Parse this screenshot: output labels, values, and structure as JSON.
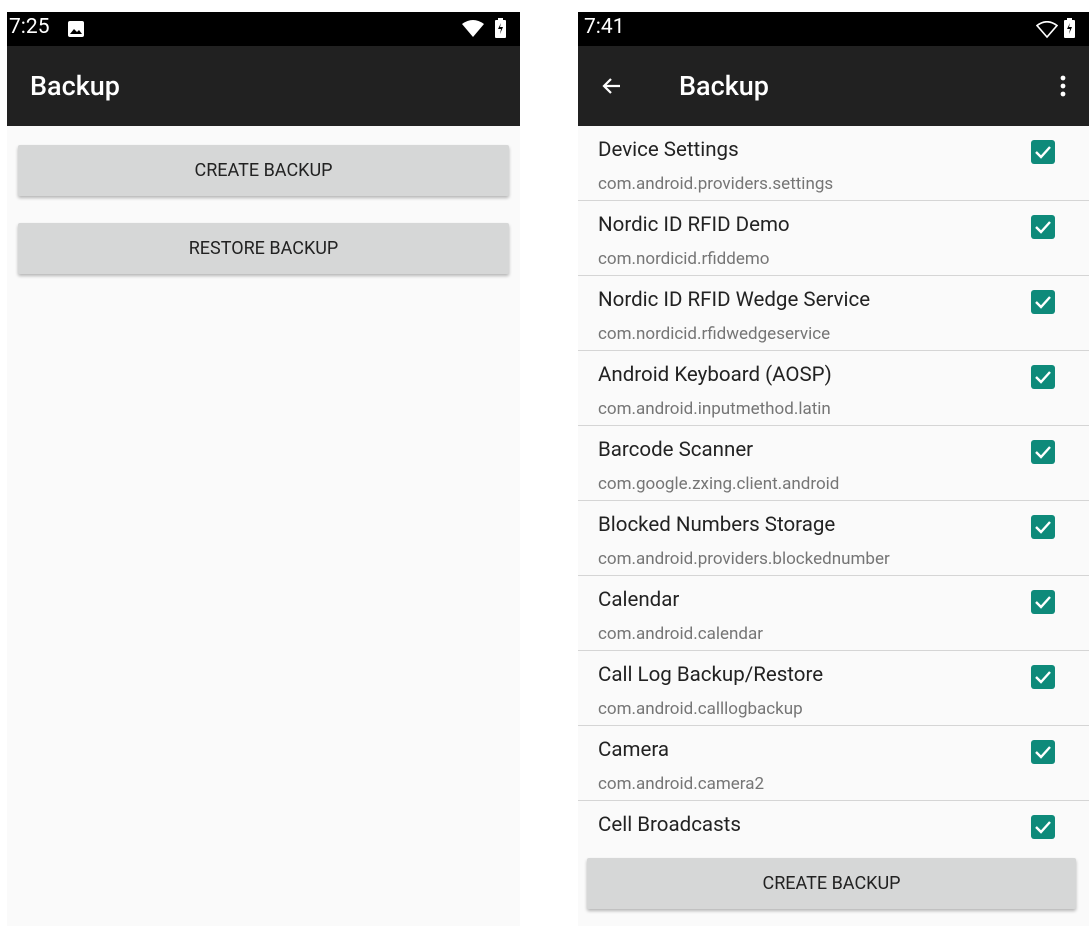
{
  "left_screen": {
    "status": {
      "time": "7:25"
    },
    "appbar": {
      "title": "Backup"
    },
    "buttons": {
      "create_label": "CREATE BACKUP",
      "restore_label": "RESTORE BACKUP"
    }
  },
  "right_screen": {
    "status": {
      "time": "7:41"
    },
    "appbar": {
      "title": "Backup"
    },
    "apps": [
      {
        "name": "Device Settings",
        "package": "com.android.providers.settings",
        "checked": true
      },
      {
        "name": "Nordic ID RFID Demo",
        "package": "com.nordicid.rfiddemo",
        "checked": true
      },
      {
        "name": "Nordic ID RFID Wedge Service",
        "package": "com.nordicid.rfidwedgeservice",
        "checked": true
      },
      {
        "name": "Android Keyboard (AOSP)",
        "package": "com.android.inputmethod.latin",
        "checked": true
      },
      {
        "name": "Barcode Scanner",
        "package": "com.google.zxing.client.android",
        "checked": true
      },
      {
        "name": "Blocked Numbers Storage",
        "package": "com.android.providers.blockednumber",
        "checked": true
      },
      {
        "name": "Calendar",
        "package": "com.android.calendar",
        "checked": true
      },
      {
        "name": "Call Log Backup/Restore",
        "package": "com.android.calllogbackup",
        "checked": true
      },
      {
        "name": "Camera",
        "package": "com.android.camera2",
        "checked": true
      },
      {
        "name": "Cell Broadcasts",
        "package": "",
        "checked": true
      }
    ],
    "buttons": {
      "create_label": "CREATE BACKUP"
    }
  },
  "colors": {
    "accent": "#0e8a7a",
    "appbar": "#212121",
    "statusbar": "#000000",
    "button": "#d6d7d7"
  },
  "icons": [
    "image-icon",
    "wifi-icon",
    "battery-icon",
    "back-arrow-icon",
    "overflow-menu-icon",
    "check-icon"
  ]
}
